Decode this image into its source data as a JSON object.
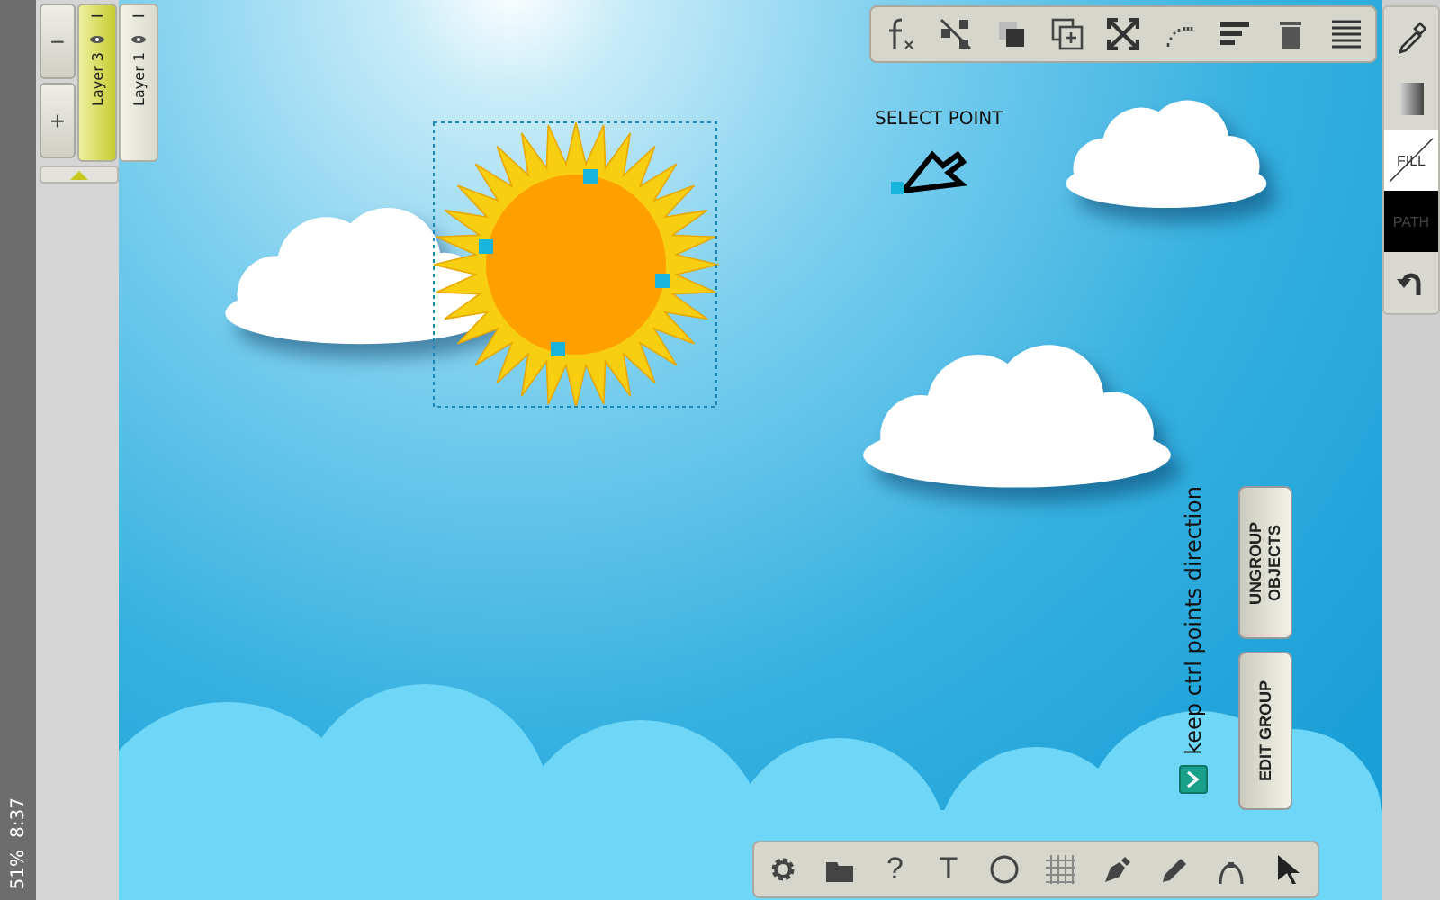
{
  "status_bar": {
    "time": "8:37",
    "battery": "51%"
  },
  "layer_controls": {
    "remove": "−",
    "add": "+"
  },
  "layers": [
    {
      "name": "Layer 3",
      "selected": true,
      "visible": true
    },
    {
      "name": "Layer 1",
      "selected": false,
      "visible": true
    }
  ],
  "canvas": {
    "hint": "SELECT POINT"
  },
  "options": {
    "label": "keep ctrl points direction",
    "checked": true
  },
  "group_buttons": [
    "UNGROUP OBJECTS",
    "EDIT GROUP"
  ],
  "style_panel": {
    "fill": "FILL",
    "path": "PATH",
    "fill_none": true
  },
  "bottom_toolbar": [
    {
      "kind": "settings"
    },
    {
      "kind": "folder"
    },
    {
      "kind": "glyph",
      "text": "?"
    },
    {
      "kind": "glyph",
      "text": "T"
    },
    {
      "kind": "circle"
    },
    {
      "kind": "grid"
    },
    {
      "kind": "pen"
    },
    {
      "kind": "pencil"
    },
    {
      "kind": "curve"
    },
    {
      "kind": "pointer"
    }
  ]
}
